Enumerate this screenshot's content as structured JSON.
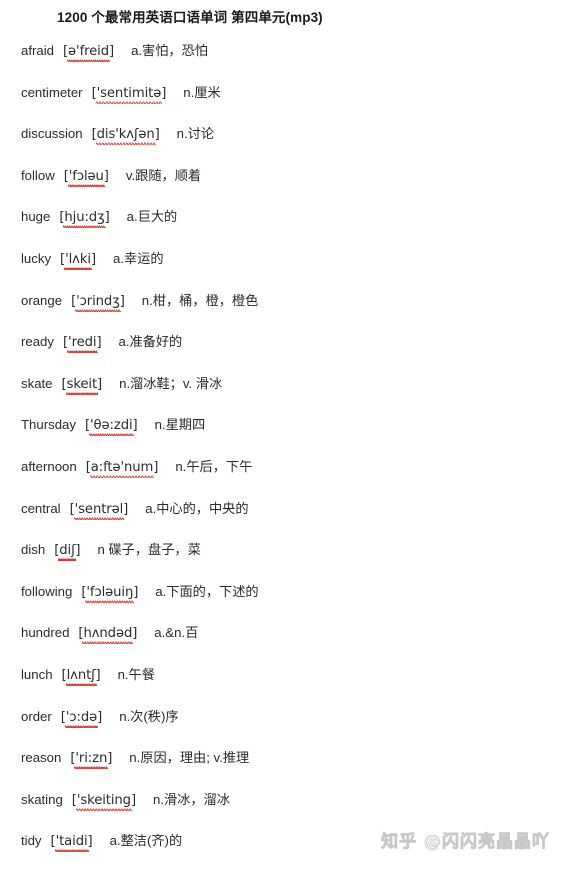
{
  "document": {
    "title": "1200 个最常用英语口语单词  第四单元(mp3)"
  },
  "watermark": {
    "text": "知乎 @闪闪亮晶晶吖"
  },
  "entries": [
    {
      "word": "afraid",
      "phonetic": "[ə'freid]",
      "definition": "a.害怕，恐怕"
    },
    {
      "word": "centimeter",
      "phonetic": "['sentimitə]",
      "definition": "n.厘米"
    },
    {
      "word": "discussion",
      "phonetic": "[dis'kʌʃən]",
      "definition": "n.讨论"
    },
    {
      "word": "follow",
      "phonetic": "['fɔləu]",
      "definition": "v.跟随，顺着"
    },
    {
      "word": "huge",
      "phonetic": "[hju:dʒ]",
      "definition": "a.巨大的"
    },
    {
      "word": "lucky",
      "phonetic": "['lʌki]",
      "definition": "a.幸运的"
    },
    {
      "word": "orange",
      "phonetic": "['ɔrindʒ]",
      "definition": "n.柑，桶，橙，橙色"
    },
    {
      "word": "ready",
      "phonetic": "['redi]",
      "definition": "a.准备好的"
    },
    {
      "word": "skate",
      "phonetic": "[skeit]",
      "definition": "n.溜冰鞋；v. 滑冰"
    },
    {
      "word": "Thursday",
      "phonetic": "['θə:zdi]",
      "definition": "n.星期四"
    },
    {
      "word": "afternoon",
      "phonetic": "[a:ftə'num]",
      "definition": "n.午后，下午"
    },
    {
      "word": "central",
      "phonetic": "['sentrəl]",
      "definition": "a.中心的，中央的"
    },
    {
      "word": "dish",
      "phonetic": "[diʃ]",
      "definition": "n 碟子，盘子，菜"
    },
    {
      "word": "following",
      "phonetic": "['fɔləuiŋ]",
      "definition": "a.下面的，下述的"
    },
    {
      "word": "hundred",
      "phonetic": "[hʌndəd]",
      "definition": "a.&n.百"
    },
    {
      "word": "lunch",
      "phonetic": "[lʌntʃ]",
      "definition": "n.午餐"
    },
    {
      "word": "order",
      "phonetic": "['ɔ:də]",
      "definition": "n.次(秩)序"
    },
    {
      "word": "reason",
      "phonetic": "['ri:zn]",
      "definition": "n.原因，理由; v.推理"
    },
    {
      "word": "skating",
      "phonetic": "['skeiting]",
      "definition": "n.滑冰，溜冰"
    },
    {
      "word": "tidy",
      "phonetic": "['taidi]",
      "definition": "a.整洁(齐)的"
    }
  ]
}
